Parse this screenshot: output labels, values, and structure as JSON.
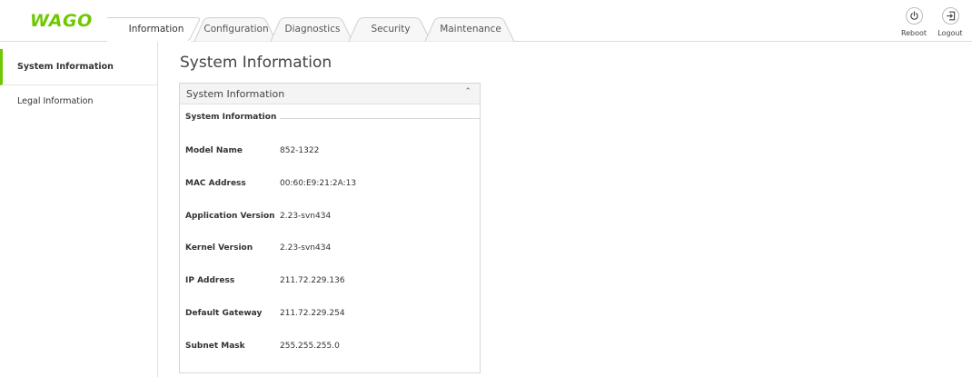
{
  "brand": {
    "logo_text": "WAGO",
    "accent_color": "#6ec800"
  },
  "tabs": [
    {
      "label": "Information",
      "active": true
    },
    {
      "label": "Configuration",
      "active": false
    },
    {
      "label": "Diagnostics",
      "active": false
    },
    {
      "label": "Security",
      "active": false
    },
    {
      "label": "Maintenance",
      "active": false
    }
  ],
  "actions": {
    "reboot": {
      "label": "Reboot",
      "icon": "power-icon"
    },
    "logout": {
      "label": "Logout",
      "icon": "logout-icon"
    }
  },
  "sidebar": {
    "items": [
      {
        "label": "System Information",
        "active": true
      },
      {
        "label": "Legal Information",
        "active": false
      }
    ]
  },
  "main": {
    "page_title": "System Information",
    "panel": {
      "title": "System Information",
      "group_title": "System Information",
      "rows": [
        {
          "label": "Model Name",
          "value": "852-1322"
        },
        {
          "label": "MAC Address",
          "value": "00:60:E9:21:2A:13"
        },
        {
          "label": "Application Version",
          "value": "2.23-svn434"
        },
        {
          "label": "Kernel Version",
          "value": "2.23-svn434"
        },
        {
          "label": "IP Address",
          "value": "211.72.229.136"
        },
        {
          "label": "Default Gateway",
          "value": "211.72.229.254"
        },
        {
          "label": "Subnet Mask",
          "value": "255.255.255.0"
        }
      ]
    }
  }
}
